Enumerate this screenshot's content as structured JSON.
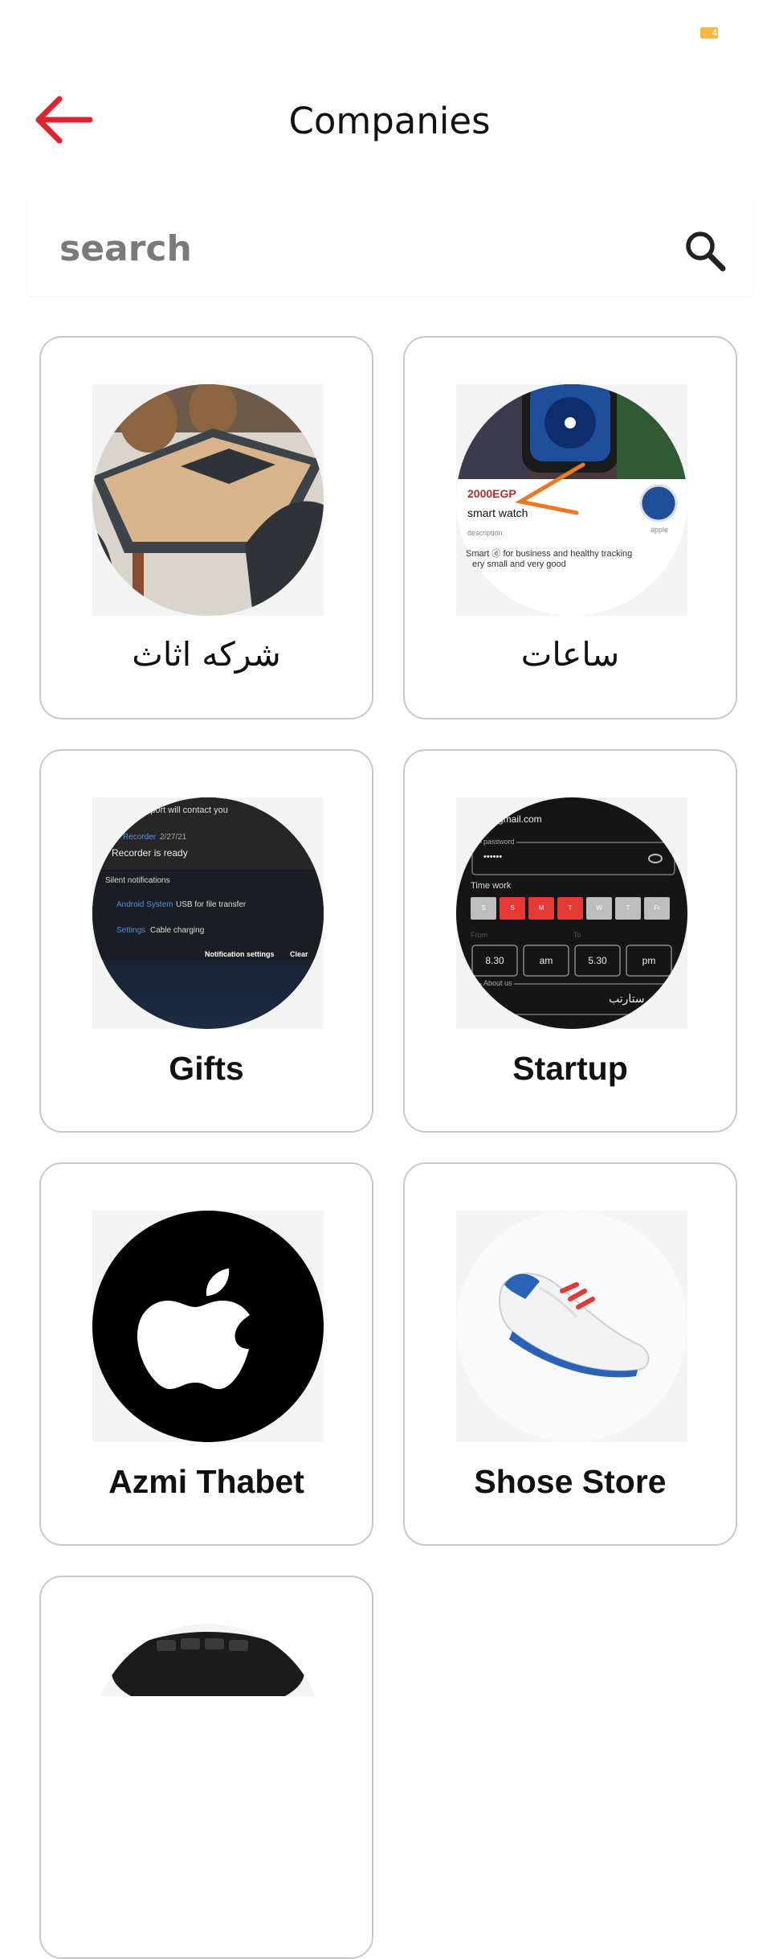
{
  "status_bar": {
    "battery_text": "4",
    "battery_color": "#f5b942"
  },
  "header": {
    "title": "Companies",
    "back_icon": "arrow-left-icon",
    "accent_color": "#e0232e"
  },
  "search": {
    "placeholder": "search",
    "icon": "search-icon"
  },
  "companies": [
    {
      "name": "شركه اثاث",
      "image": "dining-table-photo"
    },
    {
      "name": "ساعات",
      "image": "smart-watch-screenshot",
      "image_text": {
        "price": "2000EGP",
        "product": "smart watch",
        "field_label": "description",
        "desc_line1": "Smart ⓓ for business and healthy tracking",
        "desc_line2": "ery small and very good",
        "brand": "apple"
      }
    },
    {
      "name": "Gifts",
      "image": "notification-shade-screenshot",
      "image_text": {
        "line1": "upport will contact you",
        "app": "Recorder",
        "date": "2/27/21",
        "msg": "Recorder is ready",
        "section": "Silent notifications",
        "sys": "Android System",
        "sys_msg": "USB for file transfer",
        "settings": "Settings",
        "settings_msg": "Cable charging",
        "notif_settings": "Notification settings",
        "clear": "Clear"
      }
    },
    {
      "name": "Startup",
      "image": "signup-form-screenshot",
      "image_text": {
        "email": "gmail.com",
        "password_label": "password",
        "password_mask": "••••••",
        "time_work": "Time work",
        "days": [
          "S",
          "S",
          "M",
          "T",
          "W",
          "T",
          "Fr"
        ],
        "from_label": "From",
        "to_label": "To",
        "from_time": "8.30",
        "from_ampm": "am",
        "to_time": "5.30",
        "to_ampm": "pm",
        "about": "About us",
        "about_value": "ستارتب"
      }
    },
    {
      "name": "Azmi Thabet",
      "image": "apple-logo"
    },
    {
      "name": "Shose Store",
      "image": "sneaker-photo"
    },
    {
      "name": "",
      "image": "keyboard-photo"
    }
  ]
}
